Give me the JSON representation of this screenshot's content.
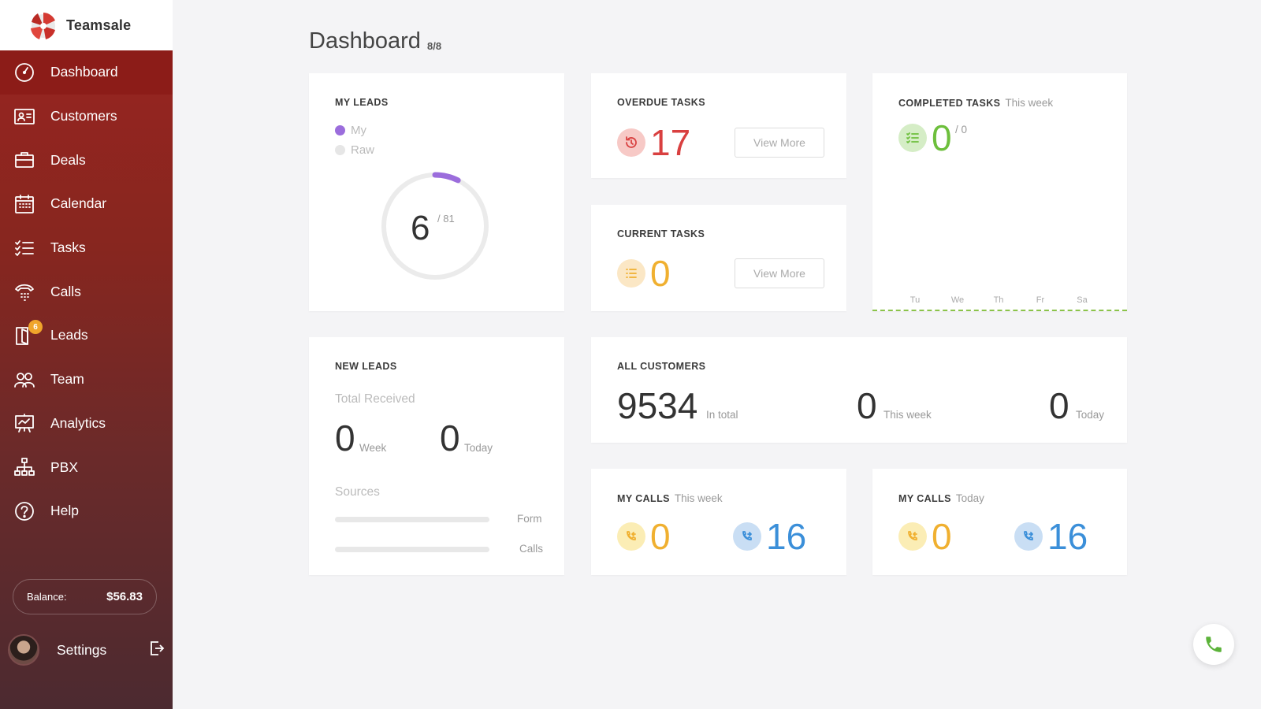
{
  "app": {
    "name": "Teamsale"
  },
  "sidebar": {
    "items": [
      {
        "label": "Dashboard",
        "icon": "gauge-icon",
        "active": true
      },
      {
        "label": "Customers",
        "icon": "contact-card-icon"
      },
      {
        "label": "Deals",
        "icon": "briefcase-icon"
      },
      {
        "label": "Calendar",
        "icon": "calendar-icon"
      },
      {
        "label": "Tasks",
        "icon": "checklist-icon"
      },
      {
        "label": "Calls",
        "icon": "phone-icon"
      },
      {
        "label": "Leads",
        "icon": "door-icon",
        "badge": "6"
      },
      {
        "label": "Team",
        "icon": "team-icon"
      },
      {
        "label": "Analytics",
        "icon": "presentation-chart-icon"
      },
      {
        "label": "PBX",
        "icon": "network-icon"
      },
      {
        "label": "Help",
        "icon": "help-icon"
      }
    ],
    "balance": {
      "label": "Balance:",
      "value": "$56.83"
    },
    "settings": {
      "label": "Settings"
    }
  },
  "header": {
    "title": "Dashboard",
    "count": "8/8"
  },
  "my_leads": {
    "title": "MY LEADS",
    "legend": [
      {
        "label": "My",
        "color": "#9b6ddc"
      },
      {
        "label": "Raw",
        "color": "#e6e6e6"
      }
    ],
    "value": "6",
    "total": "/ 81",
    "progress_fraction": 0.074
  },
  "overdue_tasks": {
    "title": "OVERDUE TASKS",
    "value": "17",
    "button": "View More",
    "color": "#d94040"
  },
  "current_tasks": {
    "title": "CURRENT TASKS",
    "value": "0",
    "button": "View More",
    "color": "#f0b030"
  },
  "completed_tasks": {
    "title": "COMPLETED TASKS",
    "subtitle": "This week",
    "value": "0",
    "total": "/ 0",
    "color": "#6dbf3c",
    "days": [
      "Tu",
      "We",
      "Th",
      "Fr",
      "Sa"
    ]
  },
  "new_leads": {
    "title": "NEW LEADS",
    "total_label": "Total Received",
    "week_value": "0",
    "week_label": "Week",
    "today_value": "0",
    "today_label": "Today",
    "sources_label": "Sources",
    "sources": [
      {
        "label": "Form",
        "value": 0
      },
      {
        "label": "Calls",
        "value": 0
      }
    ]
  },
  "all_customers": {
    "title": "ALL CUSTOMERS",
    "total_value": "9534",
    "total_label": "In total",
    "week_value": "0",
    "week_label": "This week",
    "today_value": "0",
    "today_label": "Today"
  },
  "my_calls_week": {
    "title": "MY CALLS",
    "subtitle": "This week",
    "incoming": "0",
    "outgoing": "16"
  },
  "my_calls_today": {
    "title": "MY CALLS",
    "subtitle": "Today",
    "incoming": "0",
    "outgoing": "16"
  },
  "colors": {
    "incoming": "#f0b030",
    "outgoing": "#3b8fd9",
    "accent": "#8c1c18"
  }
}
